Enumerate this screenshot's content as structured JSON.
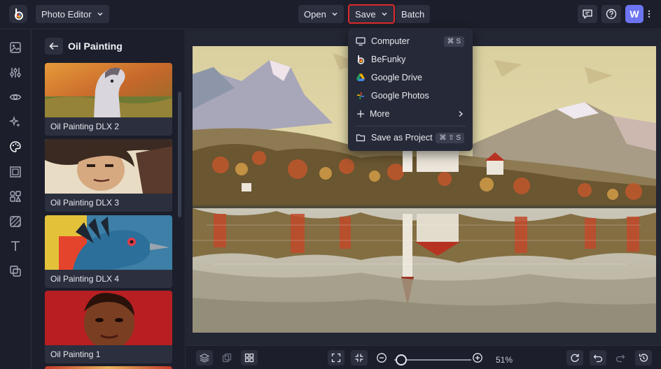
{
  "topbar": {
    "app_menu_label": "Photo Editor",
    "open_label": "Open",
    "save_label": "Save",
    "batch_label": "Batch",
    "avatar_initial": "W"
  },
  "panel": {
    "title": "Oil Painting",
    "presets": [
      {
        "label": "Oil Painting DLX 2"
      },
      {
        "label": "Oil Painting DLX 3"
      },
      {
        "label": "Oil Painting DLX 4"
      },
      {
        "label": "Oil Painting 1"
      }
    ]
  },
  "save_menu": {
    "items": [
      {
        "label": "Computer",
        "icon": "monitor-icon",
        "shortcut": "⌘ S"
      },
      {
        "label": "BeFunky",
        "icon": "befunky-icon",
        "shortcut": ""
      },
      {
        "label": "Google Drive",
        "icon": "google-drive-icon",
        "shortcut": ""
      },
      {
        "label": "Google Photos",
        "icon": "google-photos-icon",
        "shortcut": ""
      },
      {
        "label": "More",
        "icon": "plus-icon",
        "shortcut": ""
      },
      {
        "label": "Save as Project",
        "icon": "folder-icon",
        "shortcut": "⌘ ⇧ S"
      }
    ]
  },
  "bottombar": {
    "zoom_value": "51%",
    "zoom_fraction": 0.51
  },
  "colors": {
    "background": "#1c1f2b",
    "surface": "#2b2f3e",
    "accent": "#6c74f2",
    "highlight_border": "#e0282a"
  }
}
